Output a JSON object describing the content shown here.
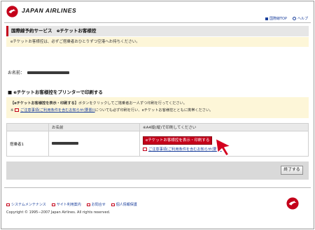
{
  "header": {
    "brand": "JAPAN AIRLINES",
    "links": [
      "国際線TOP",
      "ヘルプ"
    ]
  },
  "title": "国際線予約サービス　eチケットお客様控",
  "notice": "eチケットお客様控は、必ずご搭乗者おひとりずつ空港へお持ちください。",
  "passenger": {
    "label": "お名前："
  },
  "print_section": {
    "heading": "■ eチケットお客様控をプリンターで印刷する",
    "instruction_bold": "【eチケットお客様控を表示・印刷する】",
    "instruction_rest": "ボタンをクリックしてご搭乗者お一人ずつ印刷を行ってください。",
    "note_mark": "※",
    "note_link": "ご注意事項(ご利用条件を含むお知らせ(要置))",
    "note_rest": "についても必ず印刷を行い、eチケットお客様控とともに携帯ください。"
  },
  "table": {
    "col_name_header": "お名前",
    "col_action_header": "※A4縦(縦)で印刷してください",
    "row_label": "搭乗者1",
    "action_button": "eチケットお客様控を表示・印刷する",
    "sub_link": "ご注意事項(ご利用条件を含むお知らせ(要置)"
  },
  "end_button": "終了する",
  "footer": {
    "links": [
      "システムメンテナンス",
      "サイト利用案内",
      "お問合せ",
      "個人情報保護"
    ],
    "copyright": "Copyright © 1995−2007 Japan Airlines. All rights reserved."
  },
  "colors": {
    "accent": "#c4001a",
    "link": "#1a3f9c",
    "notice_bg": "#fdf6d8"
  }
}
